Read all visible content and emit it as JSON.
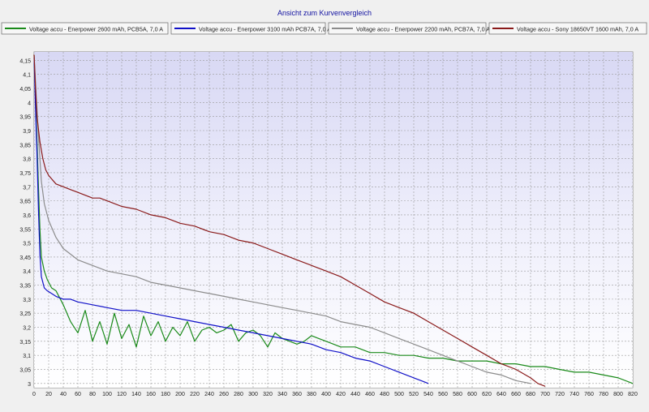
{
  "title": "Ansicht zum Kurvenvergleich",
  "chart_data": {
    "type": "line",
    "title": "Ansicht zum Kurvenvergleich",
    "xlim": [
      0,
      820
    ],
    "ylim": [
      2.985,
      4.18
    ],
    "x_ticks": [
      0,
      20,
      40,
      60,
      80,
      100,
      120,
      140,
      160,
      180,
      200,
      220,
      240,
      260,
      280,
      300,
      320,
      340,
      360,
      380,
      400,
      420,
      440,
      460,
      480,
      500,
      520,
      540,
      560,
      580,
      600,
      620,
      640,
      660,
      680,
      700,
      720,
      740,
      760,
      780,
      800,
      820
    ],
    "y_ticks": [
      {
        "value": 3.0,
        "label": "3"
      },
      {
        "value": 3.05,
        "label": "3,05"
      },
      {
        "value": 3.1,
        "label": "3,1"
      },
      {
        "value": 3.15,
        "label": "3,15"
      },
      {
        "value": 3.2,
        "label": "3,2"
      },
      {
        "value": 3.25,
        "label": "3,25"
      },
      {
        "value": 3.3,
        "label": "3,3"
      },
      {
        "value": 3.35,
        "label": "3,35"
      },
      {
        "value": 3.4,
        "label": "3,4"
      },
      {
        "value": 3.45,
        "label": "3,45"
      },
      {
        "value": 3.5,
        "label": "3,5"
      },
      {
        "value": 3.55,
        "label": "3,55"
      },
      {
        "value": 3.6,
        "label": "3,6"
      },
      {
        "value": 3.65,
        "label": "3,65"
      },
      {
        "value": 3.7,
        "label": "3,7"
      },
      {
        "value": 3.75,
        "label": "3,75"
      },
      {
        "value": 3.8,
        "label": "3,8"
      },
      {
        "value": 3.85,
        "label": "3,85"
      },
      {
        "value": 3.9,
        "label": "3,9"
      },
      {
        "value": 3.95,
        "label": "3,95"
      },
      {
        "value": 4.0,
        "label": "4"
      },
      {
        "value": 4.05,
        "label": "4,05"
      },
      {
        "value": 4.1,
        "label": "4,1"
      },
      {
        "value": 4.15,
        "label": "4,15"
      }
    ],
    "grid": true,
    "legend_position": "top",
    "series": [
      {
        "name": "Voltage accu - Enerpower 2600 mAh, PCB5A, 7,0 A",
        "color": "#1a8a1a",
        "x": [
          0,
          2,
          4,
          6,
          8,
          10,
          14,
          18,
          24,
          30,
          40,
          50,
          60,
          70,
          80,
          90,
          100,
          110,
          120,
          130,
          140,
          150,
          160,
          170,
          180,
          190,
          200,
          210,
          220,
          230,
          240,
          250,
          260,
          270,
          280,
          290,
          300,
          310,
          320,
          330,
          340,
          350,
          360,
          370,
          380,
          390,
          400,
          420,
          440,
          460,
          480,
          500,
          520,
          540,
          560,
          580,
          600,
          620,
          640,
          660,
          680,
          700,
          720,
          740,
          760,
          780,
          800,
          820
        ],
        "y": [
          4.17,
          4.0,
          3.86,
          3.7,
          3.55,
          3.45,
          3.4,
          3.37,
          3.34,
          3.33,
          3.28,
          3.22,
          3.18,
          3.26,
          3.15,
          3.22,
          3.14,
          3.25,
          3.16,
          3.21,
          3.13,
          3.24,
          3.17,
          3.22,
          3.15,
          3.2,
          3.17,
          3.22,
          3.15,
          3.19,
          3.2,
          3.18,
          3.19,
          3.21,
          3.15,
          3.18,
          3.19,
          3.17,
          3.13,
          3.18,
          3.16,
          3.15,
          3.14,
          3.15,
          3.17,
          3.16,
          3.15,
          3.13,
          3.13,
          3.11,
          3.11,
          3.1,
          3.1,
          3.09,
          3.09,
          3.08,
          3.08,
          3.08,
          3.07,
          3.07,
          3.06,
          3.06,
          3.05,
          3.04,
          3.04,
          3.03,
          3.02,
          3.0
        ]
      },
      {
        "name": "Voltage accu - Enerpower 3100 mAh PCB7A, 7,0 A",
        "color": "#1010c8",
        "x": [
          0,
          2,
          4,
          6,
          8,
          10,
          14,
          18,
          24,
          30,
          40,
          50,
          60,
          80,
          100,
          120,
          140,
          160,
          180,
          200,
          220,
          240,
          260,
          280,
          300,
          320,
          340,
          360,
          380,
          400,
          420,
          440,
          460,
          480,
          500,
          520,
          530,
          540
        ],
        "y": [
          4.16,
          3.98,
          3.82,
          3.62,
          3.46,
          3.38,
          3.34,
          3.33,
          3.32,
          3.31,
          3.3,
          3.3,
          3.29,
          3.28,
          3.27,
          3.26,
          3.26,
          3.25,
          3.24,
          3.23,
          3.22,
          3.21,
          3.2,
          3.19,
          3.18,
          3.17,
          3.16,
          3.15,
          3.14,
          3.12,
          3.11,
          3.09,
          3.08,
          3.06,
          3.04,
          3.02,
          3.01,
          3.0
        ]
      },
      {
        "name": "Voltage accu - Enerpower 2200 mAh, PCB7A, 7,0 A",
        "color": "#8c8c8c",
        "x": [
          0,
          3,
          6,
          10,
          14,
          20,
          30,
          40,
          60,
          80,
          100,
          120,
          140,
          160,
          180,
          200,
          220,
          240,
          260,
          280,
          300,
          320,
          340,
          360,
          380,
          400,
          420,
          440,
          460,
          480,
          500,
          520,
          540,
          560,
          580,
          600,
          620,
          640,
          660,
          680
        ],
        "y": [
          4.17,
          4.02,
          3.88,
          3.72,
          3.64,
          3.58,
          3.52,
          3.48,
          3.44,
          3.42,
          3.4,
          3.39,
          3.38,
          3.36,
          3.35,
          3.34,
          3.33,
          3.32,
          3.31,
          3.3,
          3.29,
          3.28,
          3.27,
          3.26,
          3.25,
          3.24,
          3.22,
          3.21,
          3.2,
          3.18,
          3.16,
          3.14,
          3.12,
          3.1,
          3.08,
          3.06,
          3.04,
          3.03,
          3.01,
          3.0
        ]
      },
      {
        "name": "Voltage accu - Sony 18650VT 1600 mAh, 7,0 A",
        "color": "#8a1a1a",
        "x": [
          0,
          2,
          4,
          8,
          12,
          16,
          20,
          30,
          40,
          50,
          60,
          70,
          80,
          90,
          100,
          120,
          140,
          160,
          180,
          200,
          220,
          240,
          260,
          280,
          300,
          320,
          340,
          360,
          380,
          400,
          420,
          440,
          460,
          480,
          500,
          520,
          540,
          560,
          580,
          600,
          620,
          640,
          660,
          680,
          690,
          700
        ],
        "y": [
          4.17,
          4.05,
          3.95,
          3.86,
          3.8,
          3.76,
          3.74,
          3.71,
          3.7,
          3.69,
          3.68,
          3.67,
          3.66,
          3.66,
          3.65,
          3.63,
          3.62,
          3.6,
          3.59,
          3.57,
          3.56,
          3.54,
          3.53,
          3.51,
          3.5,
          3.48,
          3.46,
          3.44,
          3.42,
          3.4,
          3.38,
          3.35,
          3.32,
          3.29,
          3.27,
          3.25,
          3.22,
          3.19,
          3.16,
          3.13,
          3.1,
          3.07,
          3.05,
          3.02,
          3.0,
          2.99
        ]
      }
    ]
  }
}
